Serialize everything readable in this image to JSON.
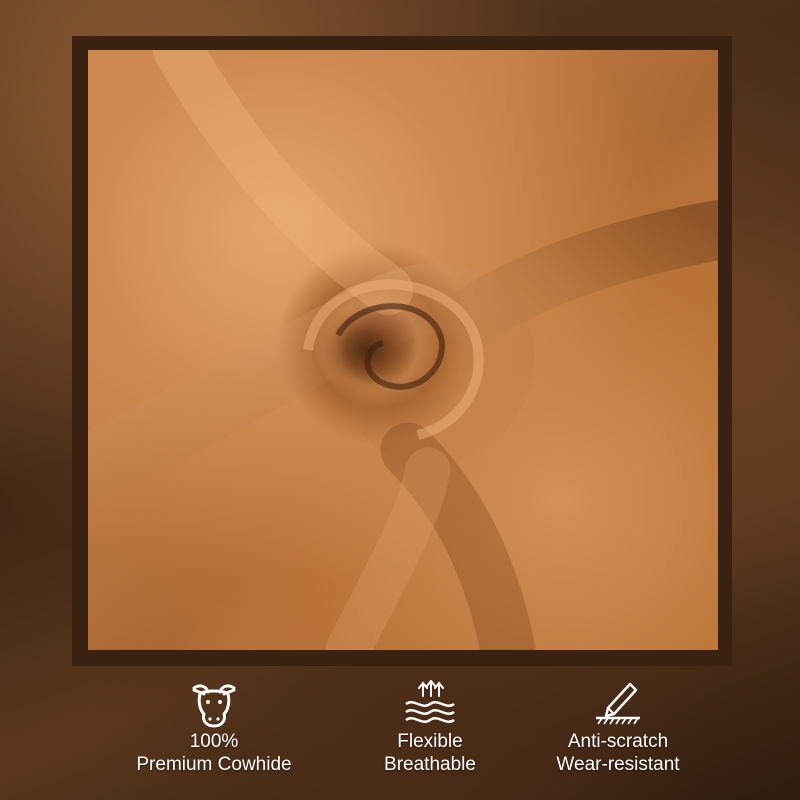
{
  "image": {
    "subject": "swirled-leather",
    "colors": {
      "leather": "#c07c45",
      "frame": "#3a2212",
      "text": "#ffffff",
      "icon": "#ffffff"
    }
  },
  "features": [
    {
      "icon": "cow-head-icon",
      "line1": "100%",
      "line2": "Premium Cowhide"
    },
    {
      "icon": "breathable-waves-icon",
      "line1": "Flexible",
      "line2": "Breathable"
    },
    {
      "icon": "scratch-pen-icon",
      "line1": "Anti-scratch",
      "line2": "Wear-resistant"
    }
  ]
}
